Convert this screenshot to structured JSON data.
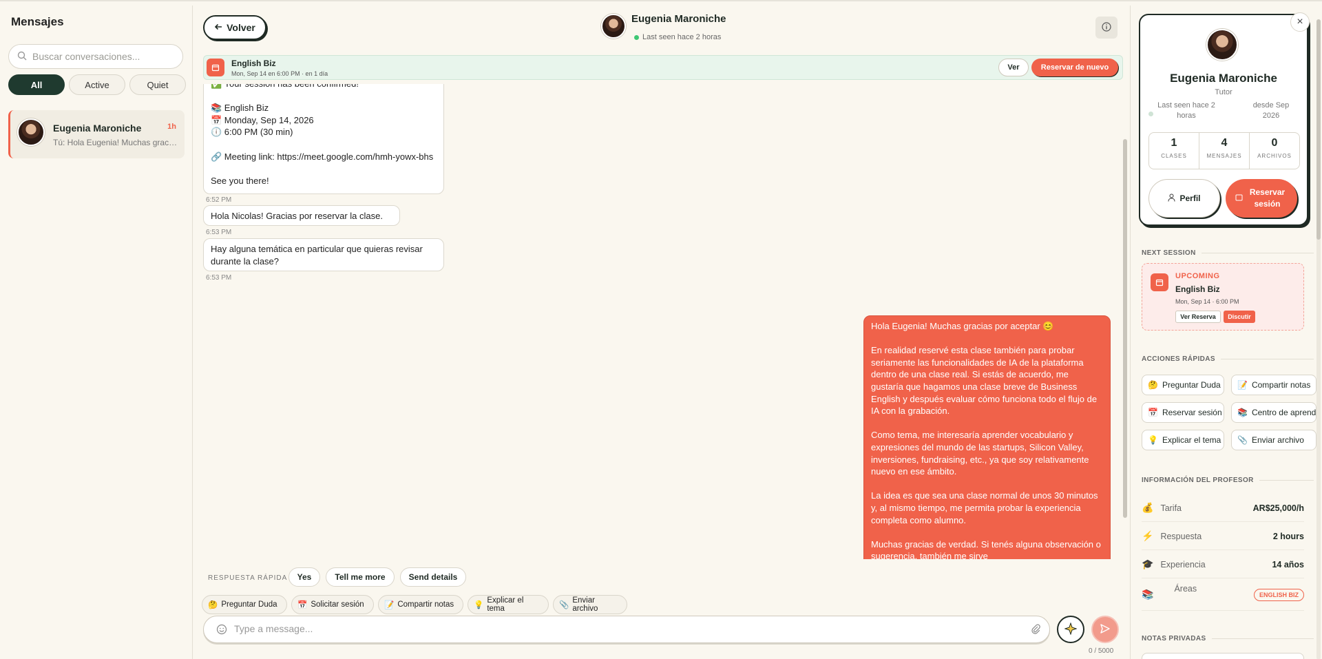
{
  "sidebar": {
    "title": "Mensajes",
    "search_placeholder": "Buscar conversaciones...",
    "filters": [
      "All",
      "Active",
      "Quiet"
    ],
    "active_filter": "All",
    "conversation": {
      "name": "Eugenia Maroniche",
      "time": "1h",
      "preview": "Tú: Hola Eugenia! Muchas gracias por aceptar"
    }
  },
  "header": {
    "back_label": "Volver",
    "name": "Eugenia Maroniche",
    "last_seen": "Last seen hace 2 horas",
    "info_icon": "info-icon"
  },
  "banner": {
    "title": "English Biz",
    "subtitle": "Mon, Sep 14 en 6:00 PM · en 1 día",
    "ver_label": "Ver",
    "reservar_label": "Reservar de nuevo"
  },
  "messages": {
    "confirm": {
      "line1": "✅ Your session has been confirmed!",
      "line2": "📚 English Biz",
      "line3": "📅 Monday, Sep 14, 2026",
      "line4": "🕕 6:00 PM (30 min)",
      "line5": "🔗 Meeting link: https://meet.google.com/hmh-yowx-bhs",
      "line6": "See you there!",
      "time": "6:52 PM"
    },
    "msg2": {
      "text": "Hola Nicolas! Gracias por reservar la clase.",
      "time": "6:53 PM"
    },
    "msg3": {
      "text": "Hay alguna temática en particular que quieras revisar durante la clase?",
      "time": "6:53 PM"
    },
    "mine": {
      "p1": "Hola Eugenia! Muchas gracias por aceptar 😊",
      "p2": "En realidad reservé esta clase también para probar seriamente las funcionalidades de IA de la plataforma dentro de una clase real. Si estás de acuerdo, me gustaría que hagamos una clase breve de Business English y después evaluar cómo funciona todo el flujo de IA con la grabación.",
      "p3": "Como tema, me interesaría aprender vocabulario y expresiones del mundo de las startups, Silicon Valley, inversiones, fundraising, etc., ya que soy relativamente nuevo en ese ámbito.",
      "p4": "La idea es que sea una clase normal de unos 30 minutos y, al mismo tiempo, me permita probar la experiencia completa como alumno.",
      "p5": "Muchas gracias de verdad. Si tenés alguna observación o sugerencia, también me sirve"
    }
  },
  "quick_reply": {
    "label": "RESPUESTA RÁPIDA",
    "options": [
      "Yes",
      "Tell me more",
      "Send details"
    ],
    "actions": [
      "Preguntar Duda",
      "Solicitar sesión",
      "Compartir notas",
      "Explicar el tema",
      "Enviar archivo"
    ]
  },
  "composer": {
    "placeholder": "Type a message...",
    "counter": "0 / 5000"
  },
  "profile": {
    "name": "Eugenia Maroniche",
    "role": "Tutor",
    "last_seen": "Last seen hace 2 horas",
    "since": "desde Sep 2026",
    "stats": [
      {
        "value": "1",
        "label": "CLASES"
      },
      {
        "value": "4",
        "label": "MENSAJES"
      },
      {
        "value": "0",
        "label": "ARCHIVOS"
      }
    ],
    "perfil_label": "Perfil",
    "reservar_label": "Reservar sesión"
  },
  "next_session": {
    "section": "NEXT SESSION",
    "status": "UPCOMING",
    "title": "English Biz",
    "date": "Mon, Sep 14 · 6:00 PM",
    "ver_label": "Ver Reserva",
    "discutir_label": "Discutir"
  },
  "quick_actions": {
    "section": "ACCIONES RÁPIDAS",
    "items": [
      "Preguntar Duda",
      "Compartir notas",
      "Reservar sesión",
      "Centro de aprend",
      "Explicar el tema",
      "Enviar archivo"
    ]
  },
  "teacher_info": {
    "section": "INFORMACIÓN DEL PROFESOR",
    "rows": [
      {
        "label": "Tarifa",
        "value": "AR$25,000/h"
      },
      {
        "label": "Respuesta",
        "value": "2 hours"
      },
      {
        "label": "Experiencia",
        "value": "14 años"
      },
      {
        "label": "Áreas",
        "value": "ENGLISH BIZ"
      }
    ]
  },
  "notes": {
    "section": "NOTAS PRIVADAS"
  },
  "colors": {
    "accent": "#f0624a",
    "dark": "#1f3a2f",
    "background": "#faf7ef"
  }
}
